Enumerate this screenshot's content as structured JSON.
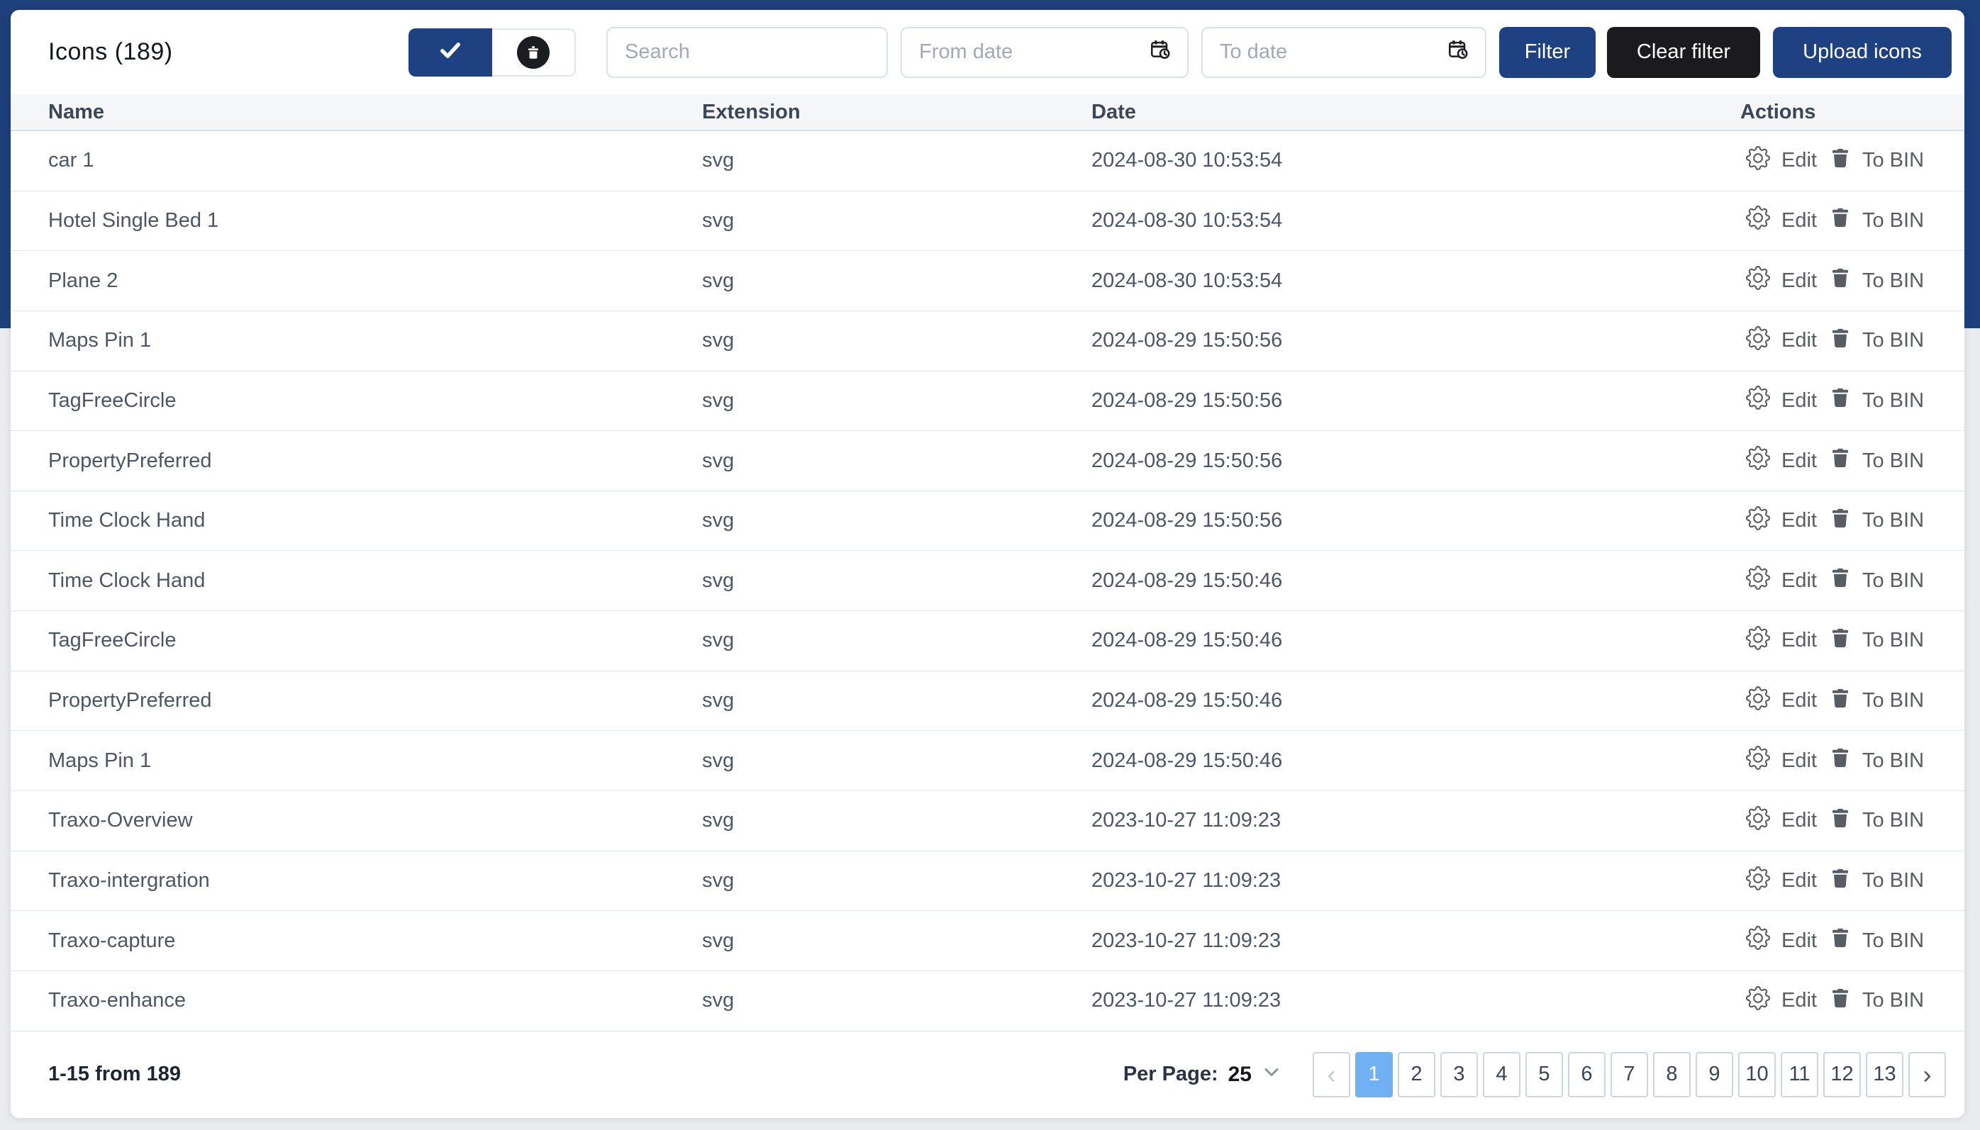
{
  "header": {
    "title": "Icons (189)",
    "toggle": {
      "active_icon": "check-icon",
      "inactive_icon": "trash-icon"
    },
    "search": {
      "placeholder": "Search"
    },
    "from_date": {
      "placeholder": "From date",
      "icon": "calendar-clock-icon"
    },
    "to_date": {
      "placeholder": "To date",
      "icon": "calendar-clock-icon"
    },
    "filter_label": "Filter",
    "clear_filter_label": "Clear filter",
    "upload_label": "Upload icons"
  },
  "table": {
    "columns": [
      "Name",
      "Extension",
      "Date",
      "Actions"
    ],
    "actions": {
      "edit_label": "Edit",
      "to_bin_label": "To BIN",
      "edit_icon": "gear-icon",
      "bin_icon": "trash-icon"
    },
    "rows": [
      {
        "name": "car 1",
        "extension": "svg",
        "date": "2024-08-30 10:53:54"
      },
      {
        "name": "Hotel Single Bed 1",
        "extension": "svg",
        "date": "2024-08-30 10:53:54"
      },
      {
        "name": "Plane 2",
        "extension": "svg",
        "date": "2024-08-30 10:53:54"
      },
      {
        "name": "Maps Pin 1",
        "extension": "svg",
        "date": "2024-08-29 15:50:56"
      },
      {
        "name": "TagFreeCircle",
        "extension": "svg",
        "date": "2024-08-29 15:50:56"
      },
      {
        "name": "PropertyPreferred",
        "extension": "svg",
        "date": "2024-08-29 15:50:56"
      },
      {
        "name": "Time Clock Hand",
        "extension": "svg",
        "date": "2024-08-29 15:50:56"
      },
      {
        "name": "Time Clock Hand",
        "extension": "svg",
        "date": "2024-08-29 15:50:46"
      },
      {
        "name": "TagFreeCircle",
        "extension": "svg",
        "date": "2024-08-29 15:50:46"
      },
      {
        "name": "PropertyPreferred",
        "extension": "svg",
        "date": "2024-08-29 15:50:46"
      },
      {
        "name": "Maps Pin 1",
        "extension": "svg",
        "date": "2024-08-29 15:50:46"
      },
      {
        "name": "Traxo-Overview",
        "extension": "svg",
        "date": "2023-10-27 11:09:23"
      },
      {
        "name": "Traxo-intergration",
        "extension": "svg",
        "date": "2023-10-27 11:09:23"
      },
      {
        "name": "Traxo-capture",
        "extension": "svg",
        "date": "2023-10-27 11:09:23"
      },
      {
        "name": "Traxo-enhance",
        "extension": "svg",
        "date": "2023-10-27 11:09:23"
      }
    ]
  },
  "footer": {
    "range_text": "1-15 from 189",
    "per_page_label": "Per Page:",
    "per_page_value": "25",
    "prev_label": "‹",
    "next_label": "›",
    "pages": [
      "1",
      "2",
      "3",
      "4",
      "5",
      "6",
      "7",
      "8",
      "9",
      "10",
      "11",
      "12",
      "13"
    ],
    "active_page": "1"
  },
  "colors": {
    "top_band_navy": "#1d3f7b",
    "primary_button_navy": "#1e4181",
    "dark_button": "#1b1b1d",
    "active_page_blue": "#70b1f4",
    "page_background": "#e9ebee",
    "row_separator": "#dfe4ed",
    "header_band": "#f5f6f8"
  }
}
